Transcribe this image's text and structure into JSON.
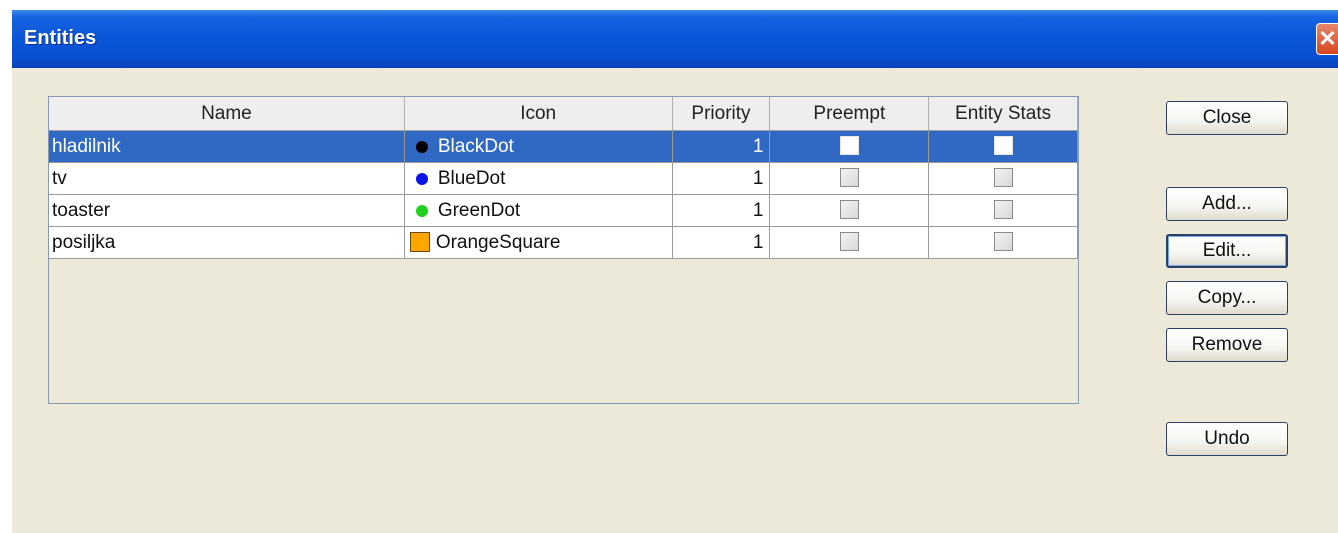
{
  "window": {
    "title": "Entities",
    "close_glyph": "✕"
  },
  "table": {
    "columns": [
      "Name",
      "Icon",
      "Priority",
      "Preempt",
      "Entity Stats"
    ],
    "rows": [
      {
        "name": "hladilnik",
        "icon": "BlackDot",
        "icon_shape": "dot",
        "icon_color": "#000000",
        "priority": "1",
        "preempt": false,
        "entity_stats": false,
        "selected": true
      },
      {
        "name": "tv",
        "icon": "BlueDot",
        "icon_shape": "dot",
        "icon_color": "#0a14e6",
        "priority": "1",
        "preempt": false,
        "entity_stats": false,
        "selected": false
      },
      {
        "name": "toaster",
        "icon": "GreenDot",
        "icon_shape": "dot",
        "icon_color": "#22d020",
        "priority": "1",
        "preempt": false,
        "entity_stats": false,
        "selected": false
      },
      {
        "name": "posiljka",
        "icon": "OrangeSquare",
        "icon_shape": "square",
        "icon_color": "#ffa500",
        "priority": "1",
        "preempt": false,
        "entity_stats": false,
        "selected": false
      }
    ]
  },
  "buttons": {
    "close": "Close",
    "add": "Add...",
    "edit": "Edit...",
    "copy": "Copy...",
    "remove": "Remove",
    "undo": "Undo"
  },
  "colors": {
    "selection": "#3069c4",
    "titlebar": "#0a55d8",
    "background": "#ece9d8"
  }
}
